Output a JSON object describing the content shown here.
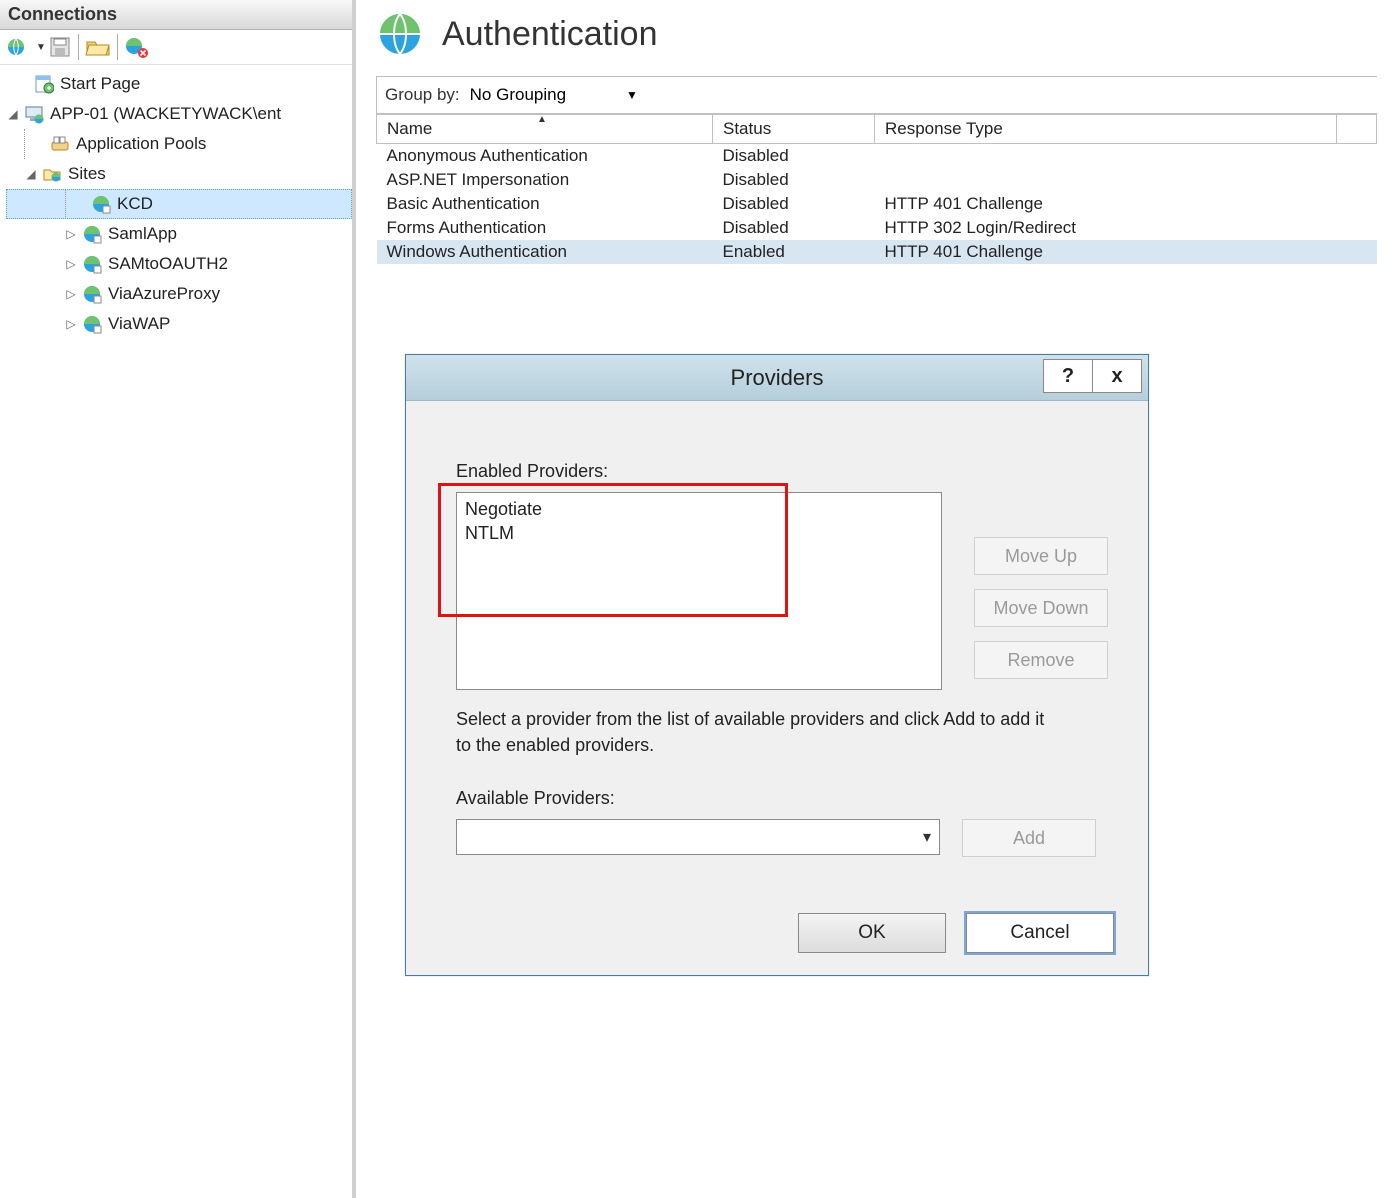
{
  "connections": {
    "header": "Connections",
    "tree": {
      "start_page": "Start Page",
      "server": "APP-01 (WACKETYWACK\\ent",
      "app_pools": "Application Pools",
      "sites": "Sites",
      "site_items": [
        "KCD",
        "SamlApp",
        "SAMtoOAUTH2",
        "ViaAzureProxy",
        "ViaWAP"
      ]
    }
  },
  "page": {
    "title": "Authentication",
    "groupby_label": "Group by:",
    "groupby_value": "No Grouping",
    "columns": {
      "name": "Name",
      "status": "Status",
      "resp": "Response Type"
    },
    "rows": [
      {
        "name": "Anonymous Authentication",
        "status": "Disabled",
        "resp": ""
      },
      {
        "name": "ASP.NET Impersonation",
        "status": "Disabled",
        "resp": ""
      },
      {
        "name": "Basic Authentication",
        "status": "Disabled",
        "resp": "HTTP 401 Challenge"
      },
      {
        "name": "Forms Authentication",
        "status": "Disabled",
        "resp": "HTTP 302 Login/Redirect"
      },
      {
        "name": "Windows Authentication",
        "status": "Enabled",
        "resp": "HTTP 401 Challenge"
      }
    ]
  },
  "dialog": {
    "title": "Providers",
    "help_glyph": "?",
    "close_glyph": "x",
    "enabled_label": "Enabled Providers:",
    "enabled_items": [
      "Negotiate",
      "NTLM"
    ],
    "move_up": "Move Up",
    "move_down": "Move Down",
    "remove": "Remove",
    "help_text": "Select a provider from the list of available providers and click Add to add it to the enabled providers.",
    "available_label": "Available Providers:",
    "combo_arrow": "▾",
    "add": "Add",
    "ok": "OK",
    "cancel": "Cancel"
  }
}
